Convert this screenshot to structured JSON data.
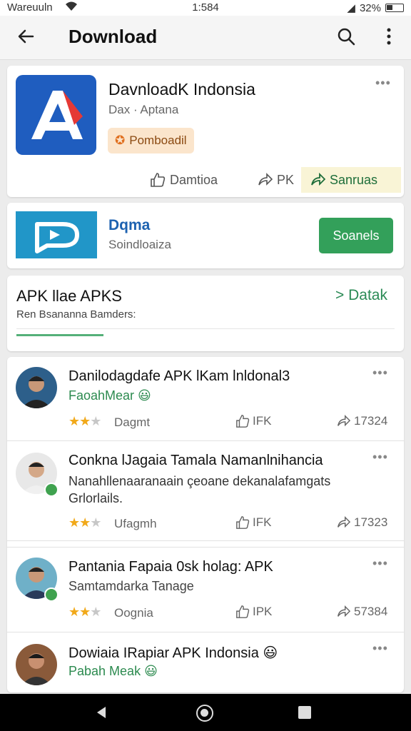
{
  "status_bar": {
    "carrier": "Wareuuln",
    "time": "1:584",
    "battery": "32%"
  },
  "app_bar": {
    "title": "Download"
  },
  "hero": {
    "name": "DavnloadK Indonsia",
    "subtitle": "Dax · Aptana",
    "badge": "Pomboadil",
    "actions": {
      "like": "Damtioa",
      "apk": "PK",
      "share": "Sanruas"
    },
    "colors": {
      "logo_bg": "#1f5dbf",
      "logo_accent": "#e53935"
    }
  },
  "promo": {
    "title": "Dqma",
    "subtitle": "Soindloaiza",
    "button": "Soanels"
  },
  "section": {
    "title": "APK llae APKS",
    "link": "Datak",
    "subtitle": "Ren Bsananna Bamders:"
  },
  "posts": [
    {
      "title": "Danilodagdafe APK lKam lnldonal3",
      "author": "FaoahMear 😃",
      "rating": 2.5,
      "meta": "Dagmt",
      "like": "IFK",
      "share": "17324"
    },
    {
      "title": "Conkna lJagaia Tamala Namanlnihancia",
      "body": "Nanahllenaaranaain çeoane dekanalafamgats Grlorlails.",
      "rating": 2.5,
      "meta": "Ufagmh",
      "like": "IFK",
      "share": "17323"
    },
    {
      "title": "Pantania Fapaia 0sk holag: APK",
      "author": "Samtamdarka Tanage",
      "rating": 2.5,
      "meta": "Oognia",
      "like": "IPK",
      "share": "57384"
    },
    {
      "title": "Dowiaia IRapiar APK Indonsia 😃",
      "author": "Pabah Meak 😃"
    }
  ]
}
